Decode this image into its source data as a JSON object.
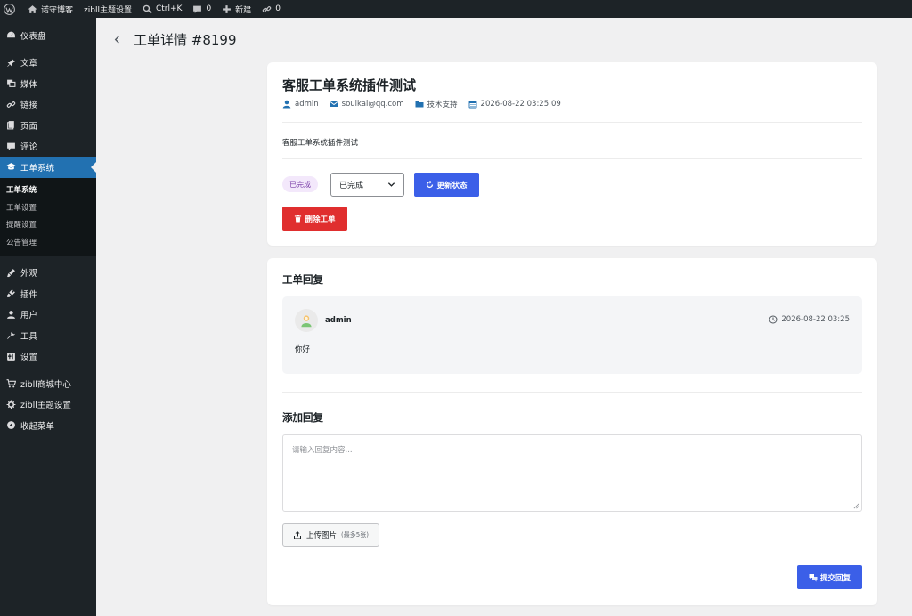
{
  "adminbar": {
    "site_name": "诺守博客",
    "theme_settings": "zibll主题设置",
    "search_shortcut": "Ctrl+K",
    "comments_count": "0",
    "new_label": "新建",
    "links_count": "0"
  },
  "sidebar": {
    "items": [
      {
        "label": "仪表盘",
        "icon": "dashboard-icon"
      },
      {
        "label": "文章",
        "icon": "pin-icon"
      },
      {
        "label": "媒体",
        "icon": "media-icon"
      },
      {
        "label": "链接",
        "icon": "link-icon"
      },
      {
        "label": "页面",
        "icon": "page-icon"
      },
      {
        "label": "评论",
        "icon": "comment-icon"
      },
      {
        "label": "工单系统",
        "icon": "ticket-icon"
      },
      {
        "label": "外观",
        "icon": "brush-icon"
      },
      {
        "label": "插件",
        "icon": "plugin-icon"
      },
      {
        "label": "用户",
        "icon": "user-icon"
      },
      {
        "label": "工具",
        "icon": "wrench-icon"
      },
      {
        "label": "设置",
        "icon": "settings-icon"
      },
      {
        "label": "zibll商城中心",
        "icon": "cart-icon"
      },
      {
        "label": "zibll主题设置",
        "icon": "gear-icon"
      },
      {
        "label": "收起菜单",
        "icon": "collapse-icon"
      }
    ],
    "submenu": [
      "工单系统",
      "工单设置",
      "提醒设置",
      "公告管理"
    ]
  },
  "page": {
    "title": "工单详情 #8199"
  },
  "ticket": {
    "title": "客服工单系统插件测试",
    "author": "admin",
    "email": "soulkai@qq.com",
    "category": "技术支持",
    "date": "2026-08-22 03:25:09",
    "body": "客服工单系统插件测试",
    "status_badge": "已完成",
    "status_select": "已完成",
    "update_button": "更新状态",
    "delete_button": "删除工单",
    "colors": {
      "primary": "#3b5fe8",
      "danger": "#e02e2e",
      "badge_bg": "#f3e8fb",
      "badge_text": "#7b3fa8"
    }
  },
  "replies": {
    "section_title": "工单回复",
    "items": [
      {
        "author": "admin",
        "time": "2026-08-22 03:25",
        "content": "你好"
      }
    ]
  },
  "add_reply": {
    "section_title": "添加回复",
    "placeholder": "请输入回复内容...",
    "upload_label": "上传图片",
    "upload_hint": "(最多5张)",
    "submit_label": "提交回复"
  }
}
